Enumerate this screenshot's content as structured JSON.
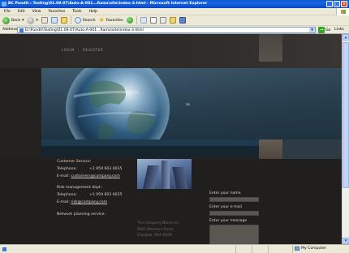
{
  "window": {
    "title": "BC Pundit : Testing\\01.09.07\\Auto-A-001...Ramz\\site\\index-3.html - Microsoft Internet Explorer",
    "min_glyph": "_",
    "max_glyph": "□",
    "close_glyph": "×"
  },
  "menu": [
    "File",
    "Edit",
    "View",
    "Favorites",
    "Tools",
    "Help"
  ],
  "toolbar": {
    "back_label": "Back",
    "search_label": "Search",
    "favorites_label": "Favorites"
  },
  "address": {
    "label": "Address",
    "value": "D:\\Pundit\\Testing\\01.09.07\\Auto-A-001...Ramz\\site\\index-3.html",
    "go_label": "Go",
    "links_label": "Links"
  },
  "site": {
    "nav": {
      "login": "LOGIN",
      "separator": "|",
      "register": "REGISTER"
    },
    "banner_arrows": "››››",
    "contacts": {
      "customer_service": "Customer Service:",
      "telephone_label": "Telephone:",
      "telephone_1": "+1 959 603 6035",
      "email_label": "E-mail:",
      "email_1": "customers@company.com",
      "risk_dept": "Risk management dept.:",
      "telephone_2": "+1 959 603 6035",
      "email_2": "risk@company.com",
      "network_planning": "Network planning service:"
    },
    "address_lines": [
      "The Company Name Inc.",
      "8901 Marmora Road,",
      "Glasgow, D04 89GR."
    ],
    "form": {
      "name_label": "Enter your name",
      "email_label": "Enter your e-mail",
      "message_label": "Enter your message"
    }
  },
  "status": {
    "zone_label": "My Computer"
  },
  "colors": {
    "title_blue": "#0a5ad4",
    "page_background": "#242221",
    "banner_blue": "#2d4556"
  }
}
